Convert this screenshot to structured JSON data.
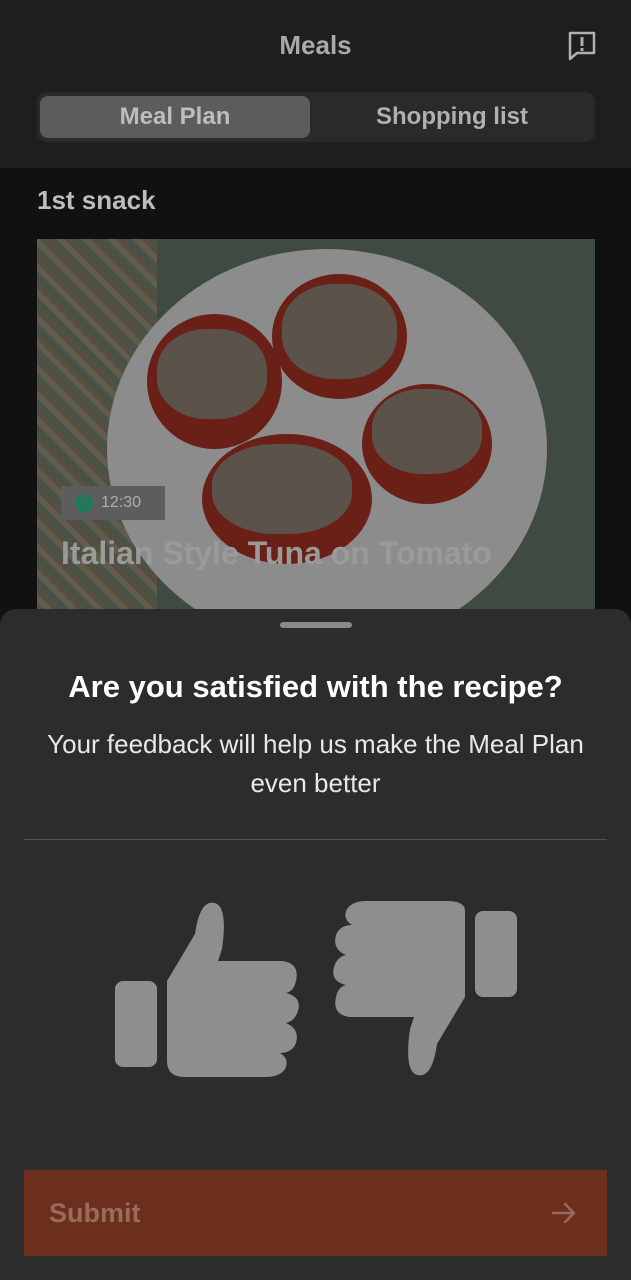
{
  "header": {
    "title": "Meals",
    "report_icon": "report-icon"
  },
  "tabs": [
    {
      "label": "Meal Plan",
      "active": true
    },
    {
      "label": "Shopping list",
      "active": false
    }
  ],
  "section": {
    "title": "1st snack"
  },
  "recipe": {
    "time": "12:30",
    "name": "Italian Style Tuna on Tomato"
  },
  "feedback_sheet": {
    "question": "Are you satisfied with the recipe?",
    "subtitle": "Your feedback will help us make the Meal Plan even better",
    "thumbs_up_icon": "thumbs-up-icon",
    "thumbs_down_icon": "thumbs-down-icon",
    "submit_label": "Submit"
  },
  "colors": {
    "accent": "#6b2f1c",
    "sheet_bg": "#2c2c2c"
  }
}
